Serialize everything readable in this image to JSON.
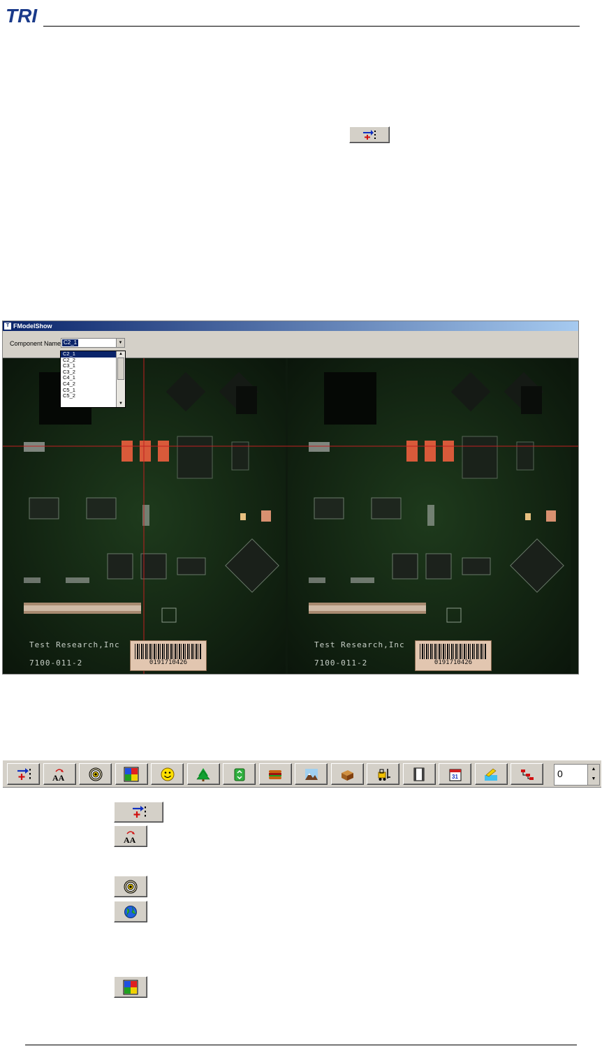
{
  "header": {
    "logo_text": "TRI"
  },
  "app_window": {
    "title": "FModelShow",
    "component_label": "Component Name:",
    "component_value": "C2_1",
    "dropdown_options": [
      "C2_1",
      "C2_2",
      "C3_1",
      "C3_2",
      "C4_1",
      "C4_2",
      "C5_1",
      "C5_2"
    ],
    "selected_index": 0
  },
  "board": {
    "left": {
      "company": "Test Research,Inc",
      "part": "7100-011-2",
      "barcode": "0191710426"
    },
    "right": {
      "company": "Test Research,Inc",
      "part": "7100-011-2",
      "barcode": "0191710426"
    }
  },
  "toolbar": {
    "buttons": [
      "position-icon",
      "text-aa-icon",
      "target-icon",
      "puzzle-icon",
      "smiley-icon",
      "tree-icon",
      "recycle-icon",
      "burger-icon",
      "landscape-icon",
      "box-icon",
      "forklift-icon",
      "film-icon",
      "calendar-icon",
      "water-icon",
      "branch-icon"
    ],
    "spin_value": "0"
  },
  "legend_icons": [
    "position-icon",
    "text-aa-icon",
    "target-icon",
    "globe-icon",
    "puzzle-icon"
  ]
}
